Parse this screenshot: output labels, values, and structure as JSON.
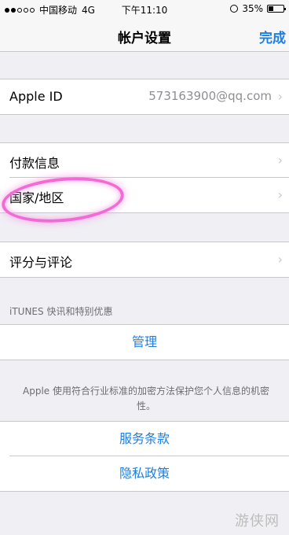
{
  "status_bar": {
    "carrier": "中国移动",
    "network": "4G",
    "time": "下午11:10",
    "battery": "35%",
    "battery_level": 0.35
  },
  "nav": {
    "title": "帐户设置",
    "done": "完成"
  },
  "apple_id": {
    "label": "Apple ID",
    "value": "573163900@qq.com"
  },
  "group2": {
    "payment": "付款信息",
    "region": "国家/地区"
  },
  "group3": {
    "ratings": "评分与评论"
  },
  "itunes": {
    "header": "iTUNES 快讯和特别优惠",
    "manage": "管理"
  },
  "footer": {
    "text": "Apple 使用符合行业标准的加密方法保护您个人信息的机密性。",
    "terms": "服务条款",
    "privacy": "隐私政策"
  },
  "watermark": "游侠网",
  "colors": {
    "accent": "#1e7fe0",
    "highlight": "#f26bd4",
    "background": "#efeff4"
  }
}
